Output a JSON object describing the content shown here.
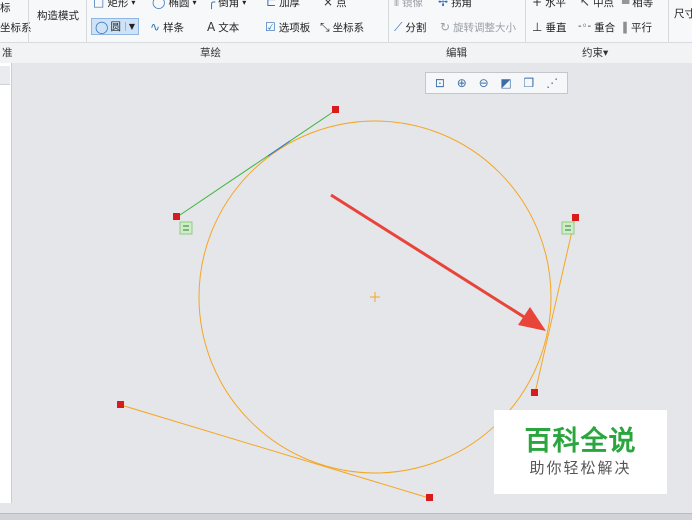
{
  "ribbon": {
    "left_items": [
      "标",
      "坐标系"
    ],
    "construct_mode": "构造模式",
    "sketch": {
      "rect": "矩形",
      "ellipse": "椭圆",
      "fillet": "倒角",
      "thicken": "加厚",
      "point": "点",
      "circle": "圆",
      "spline": "样条",
      "text": "文本",
      "palette": "选项板",
      "coordsys": "坐标系"
    },
    "edit": {
      "mirror": "镜像",
      "trim": "拐角",
      "divide": "分割",
      "rotate_resize": "旋转调整大小"
    },
    "constrain": {
      "horizontal": "水平",
      "midpoint": "中点",
      "equal": "相等",
      "vertical": "垂直",
      "coincident": "重合",
      "parallel": "平行"
    },
    "dimension": "尺寸",
    "groups": {
      "datum": "准",
      "sketch": "草绘",
      "edit": "编辑",
      "constrain": "约束▾"
    }
  },
  "view_toolbar": {
    "icons": [
      "refit-icon",
      "zoom-in-icon",
      "zoom-out-icon",
      "repaint-icon",
      "display-style-icon",
      "sketch-display-icon"
    ]
  },
  "watermark": {
    "title": "百科全说",
    "subtitle": "助你轻松解决"
  },
  "colors": {
    "curve": "#f5a623",
    "green_line": "#3cb43c",
    "arrow": "#e8443a",
    "point": "#d81b1b",
    "canvas": "#e4e6ea"
  }
}
